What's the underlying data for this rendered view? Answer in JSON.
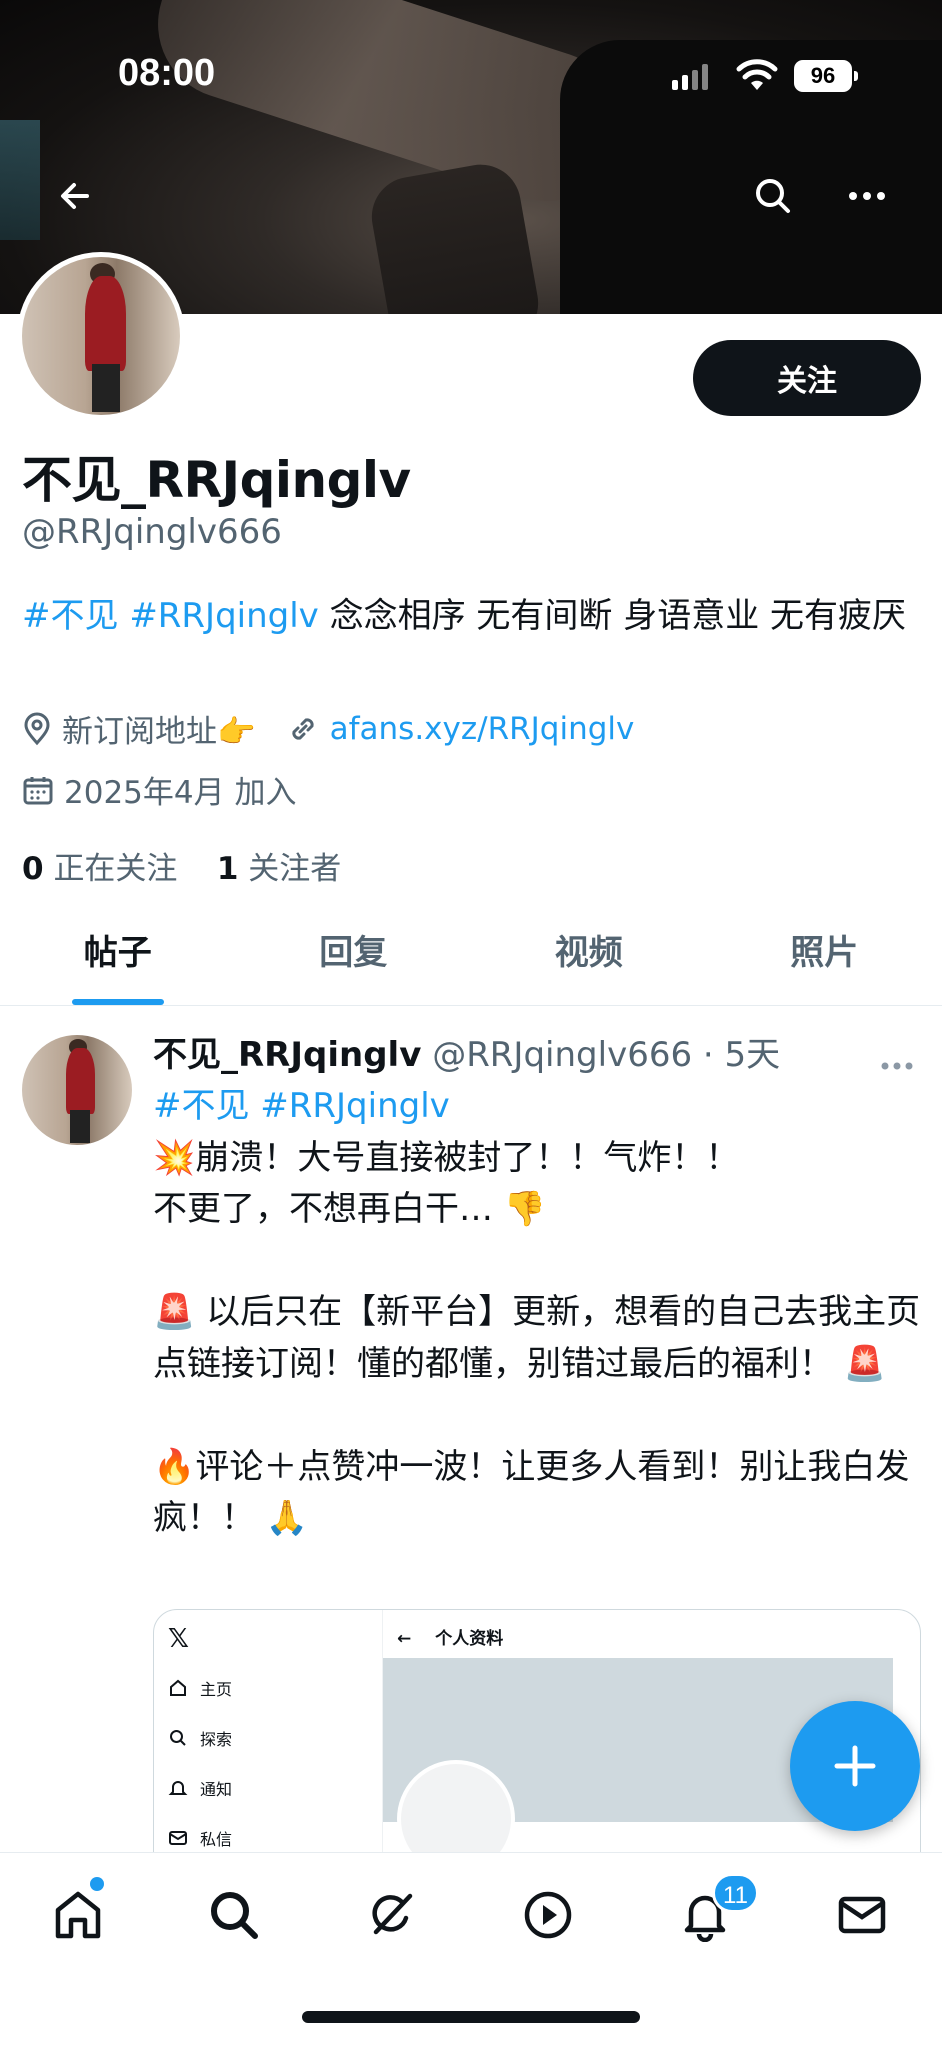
{
  "status_bar": {
    "time": "08:00",
    "battery": "96"
  },
  "profile": {
    "display_name": "不见_RRJqinglv",
    "handle": "@RRJqinglv666",
    "follow_label": "关注",
    "bio": {
      "tags": [
        "#不见",
        "#RRJqinglv"
      ],
      "text": "念念相序 无有间断 身语意业 无有疲厌"
    },
    "location": "新订阅地址👉",
    "website": "afans.xyz/RRJqinglv",
    "joined": "2025年4月 加入",
    "following_count": "0",
    "following_label": "正在关注",
    "followers_count": "1",
    "followers_label": "关注者"
  },
  "tabs": [
    {
      "label": "帖子",
      "active": true
    },
    {
      "label": "回复",
      "active": false
    },
    {
      "label": "视频",
      "active": false
    },
    {
      "label": "照片",
      "active": false
    }
  ],
  "post": {
    "author_name": "不见_RRJqinglv",
    "author_handle": "@RRJqinglv666",
    "time": "· 5天",
    "tags": "#不见 #RRJqinglv",
    "text": "💥崩溃！大号直接被封了！！气炸！！\n不更了，不想再白干… 👎\n\n🚨 以后只在【新平台】更新，想看的自己去我主页点链接订阅！懂的都懂，别错过最后的福利！ 🚨\n\n🔥评论＋点赞冲一波！让更多人看到！别让我白发疯！！ 🙏",
    "embedded_screenshot": {
      "page_title": "个人资料",
      "menu": [
        "主页",
        "探索",
        "通知",
        "私信"
      ]
    }
  },
  "bottom_nav": {
    "items": [
      "home-icon",
      "search-icon",
      "grok-icon",
      "video-icon",
      "notifications-icon",
      "messages-icon"
    ],
    "notifications_badge": "11"
  },
  "colors": {
    "accent": "#1d9bf0",
    "text": "#0f1419",
    "secondary": "#536471"
  }
}
